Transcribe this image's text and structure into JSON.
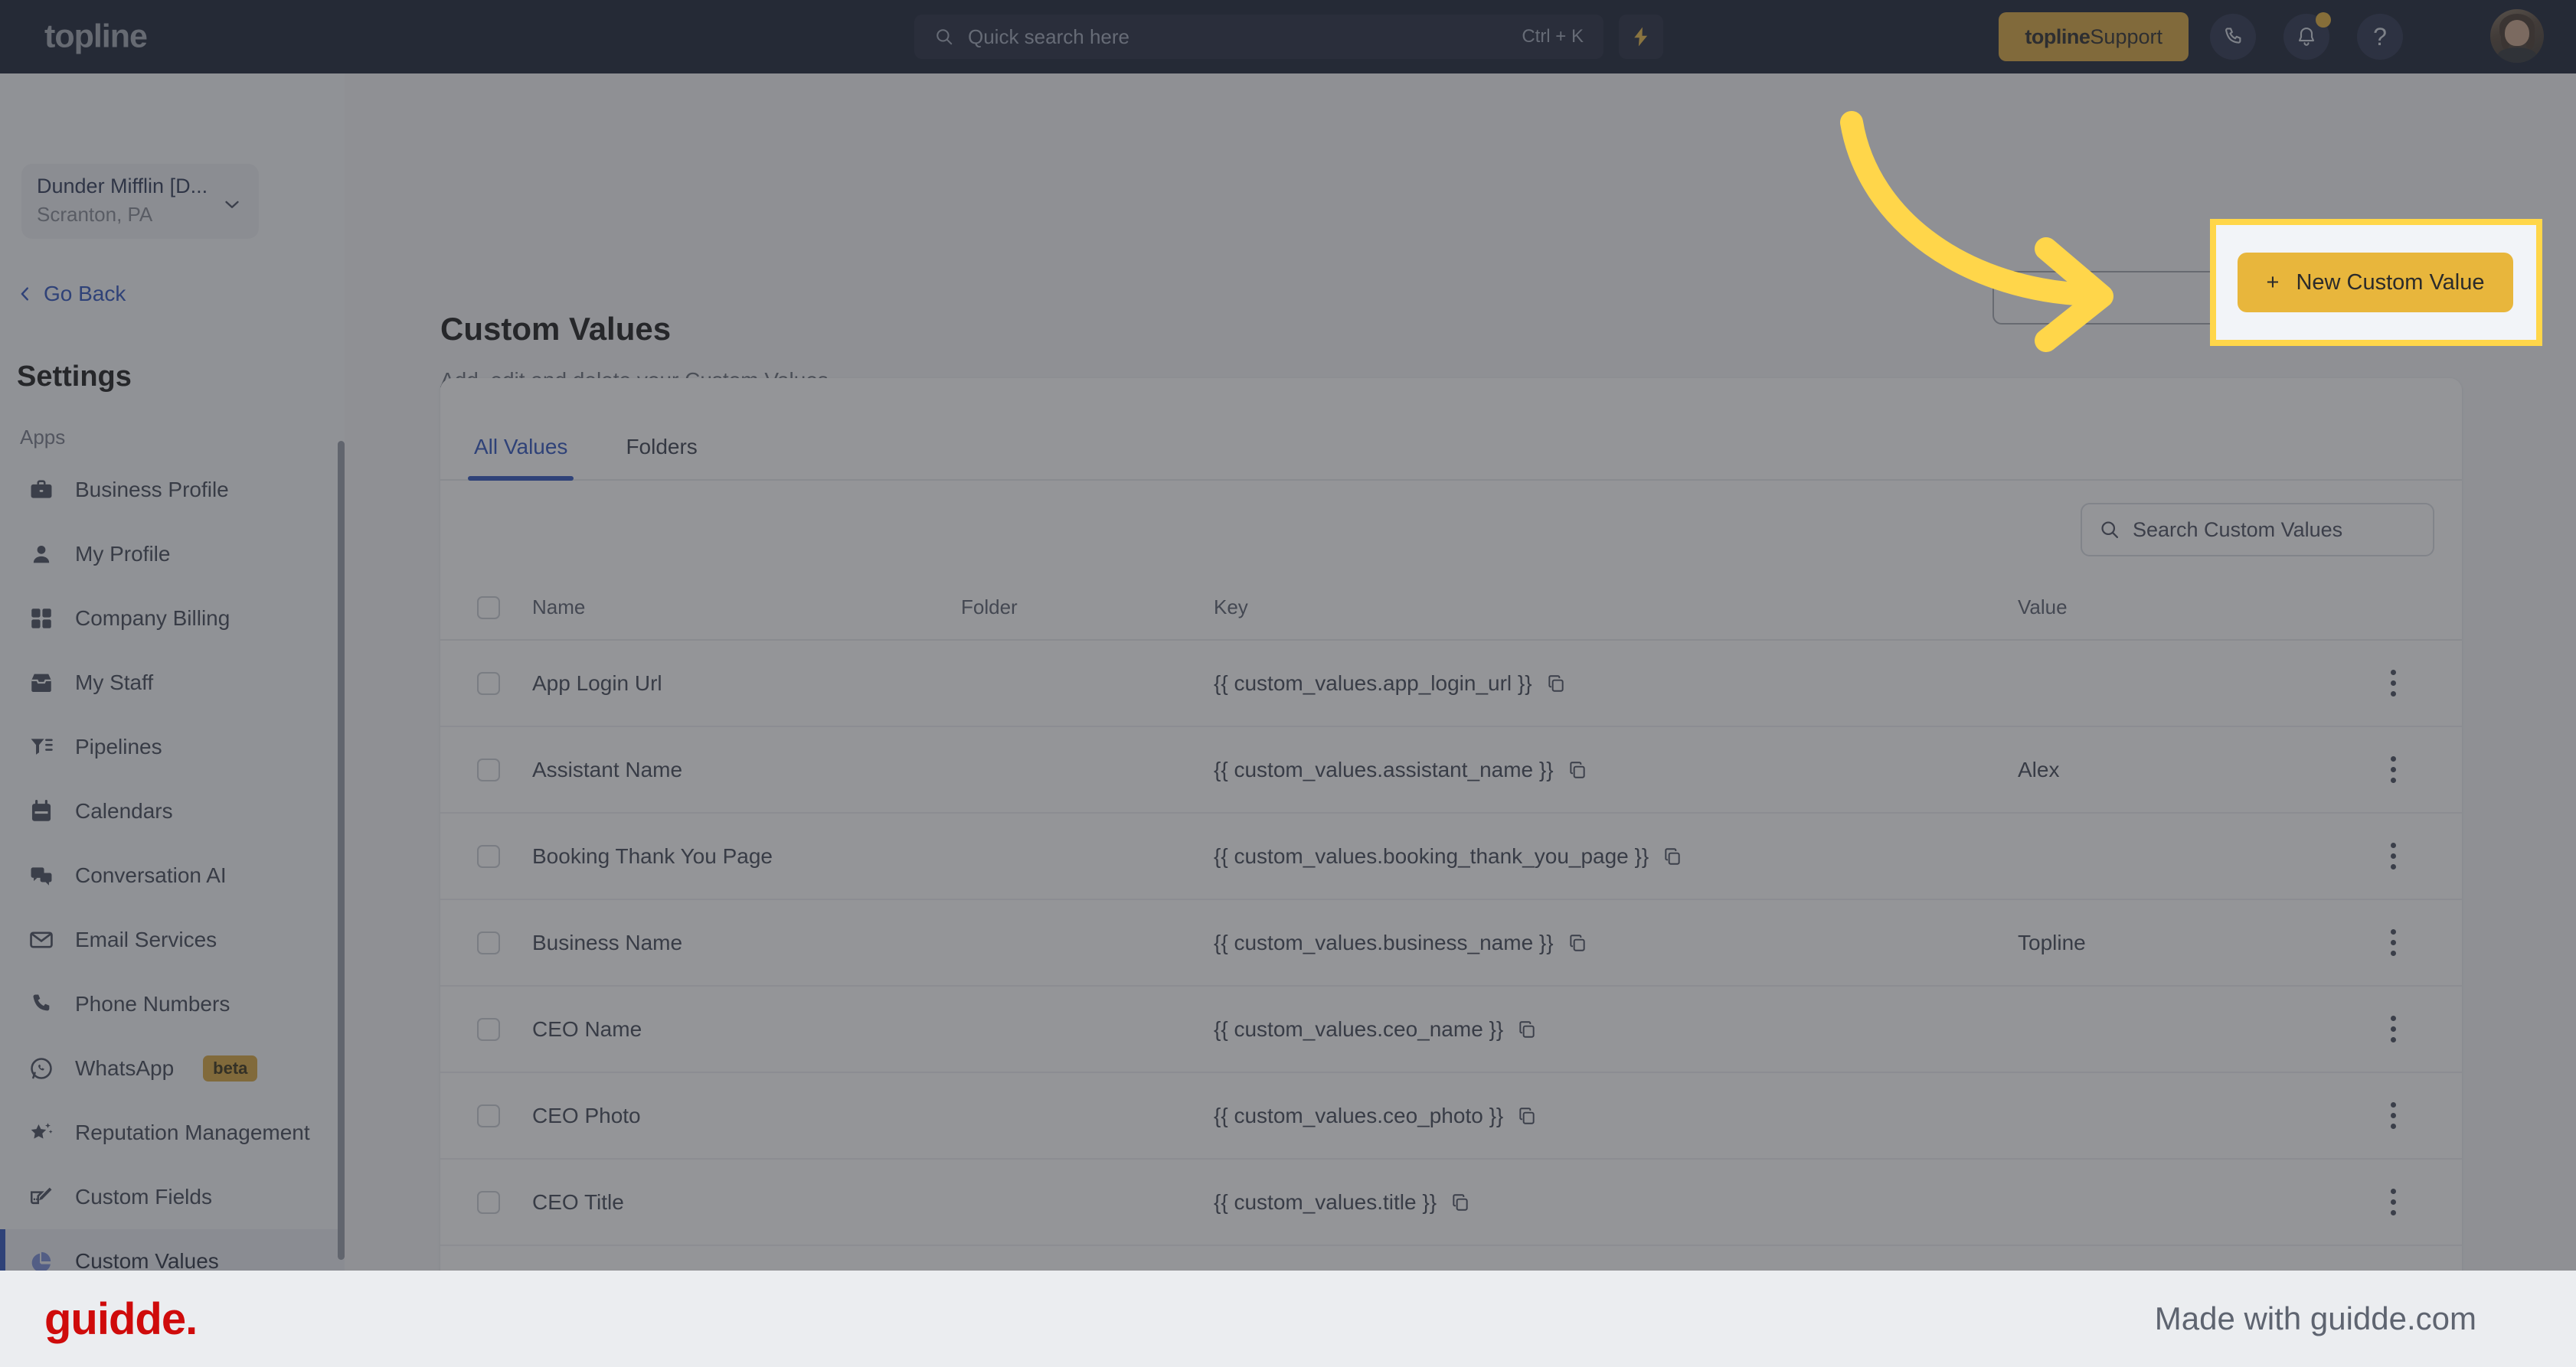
{
  "topbar": {
    "brand": "topline",
    "search": {
      "placeholder": "Quick search here",
      "shortcut": "Ctrl + K",
      "icon": "search-icon"
    },
    "bolt_icon": "lightning-bolt-icon",
    "support_brand": "topline",
    "support_label": " Support",
    "phone_icon": "phone-icon",
    "bell_icon": "bell-icon",
    "help_icon": "question-mark-icon",
    "avatar": "user-avatar"
  },
  "sidebar": {
    "location_name": "Dunder Mifflin [D...",
    "location_sub": "Scranton, PA",
    "go_back": "Go Back",
    "settings_heading": "Settings",
    "apps_heading": "Apps",
    "items": [
      {
        "label": "Business Profile",
        "icon": "briefcase-icon",
        "active": false
      },
      {
        "label": "My Profile",
        "icon": "person-icon",
        "active": false
      },
      {
        "label": "Company Billing",
        "icon": "calculator-icon",
        "active": false
      },
      {
        "label": "My Staff",
        "icon": "inbox-icon",
        "active": false
      },
      {
        "label": "Pipelines",
        "icon": "filter-icon",
        "active": false
      },
      {
        "label": "Calendars",
        "icon": "calendar-icon",
        "active": false
      },
      {
        "label": "Conversation AI",
        "icon": "chat-bubbles-icon",
        "active": false
      },
      {
        "label": "Email Services",
        "icon": "envelope-icon",
        "active": false
      },
      {
        "label": "Phone Numbers",
        "icon": "phone-icon",
        "active": false
      },
      {
        "label": "WhatsApp",
        "icon": "whatsapp-icon",
        "active": false,
        "badge": "beta"
      },
      {
        "label": "Reputation Management",
        "icon": "star-sparkle-icon",
        "active": false
      },
      {
        "label": "Custom Fields",
        "icon": "pencil-box-icon",
        "active": false
      },
      {
        "label": "Custom Values",
        "icon": "pie-chart-icon",
        "active": true
      }
    ]
  },
  "main": {
    "title": "Custom Values",
    "subtitle": "Add, edit and delete your Custom Values.",
    "new_button_label": "New Custom Value",
    "new_button_plus": "+",
    "tabs": [
      {
        "label": "All Values",
        "active": true
      },
      {
        "label": "Folders",
        "active": false
      }
    ],
    "search": {
      "placeholder": "Search Custom Values",
      "icon": "search-icon"
    },
    "table": {
      "columns": [
        "Name",
        "Folder",
        "Key",
        "Value"
      ],
      "rows": [
        {
          "name": "App Login Url",
          "folder": "",
          "key": "{{ custom_values.app_login_url }}",
          "value": ""
        },
        {
          "name": "Assistant Name",
          "folder": "",
          "key": "{{ custom_values.assistant_name }}",
          "value": "Alex"
        },
        {
          "name": "Booking Thank You Page",
          "folder": "",
          "key": "{{ custom_values.booking_thank_you_page }}",
          "value": ""
        },
        {
          "name": "Business Name",
          "folder": "",
          "key": "{{ custom_values.business_name }}",
          "value": "Topline"
        },
        {
          "name": "CEO Name",
          "folder": "",
          "key": "{{ custom_values.ceo_name }}",
          "value": ""
        },
        {
          "name": "CEO Photo",
          "folder": "",
          "key": "{{ custom_values.ceo_photo }}",
          "value": ""
        },
        {
          "name": "CEO Title",
          "folder": "",
          "key": "{{ custom_values.title }}",
          "value": ""
        }
      ]
    }
  },
  "footer": {
    "logo": "guidde.",
    "made_with": "Made with guidde.com"
  },
  "colors": {
    "topbar_bg": "#0b1226",
    "accent_gold": "#d5a032",
    "highlight_yellow": "#ffd64a",
    "link_blue": "#1f47b8",
    "guidde_red": "#cf0b0b"
  }
}
